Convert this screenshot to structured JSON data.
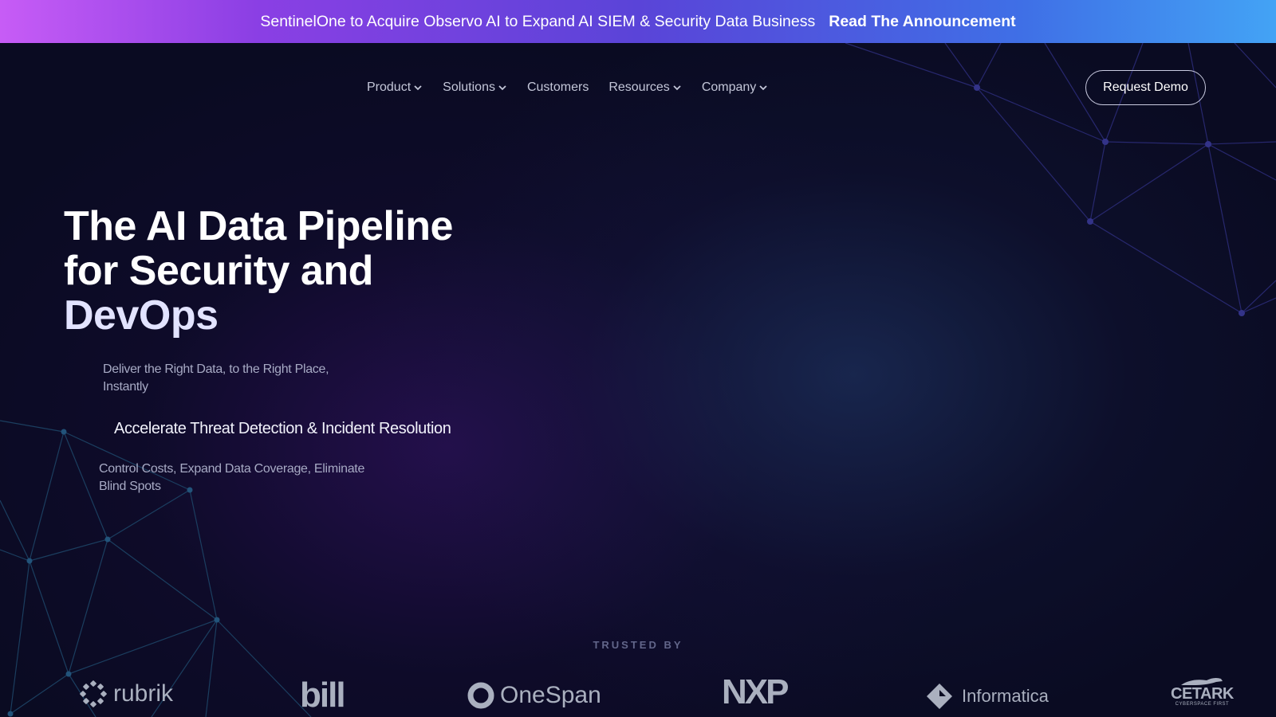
{
  "banner": {
    "text": "SentinelOne to Acquire Observo AI to Expand AI SIEM & Security Data Business",
    "link_label": "Read The Announcement"
  },
  "nav": {
    "items": [
      {
        "label": "Product",
        "has_dropdown": true
      },
      {
        "label": "Solutions",
        "has_dropdown": true
      },
      {
        "label": "Customers",
        "has_dropdown": false
      },
      {
        "label": "Resources",
        "has_dropdown": true
      },
      {
        "label": "Company",
        "has_dropdown": true
      }
    ],
    "cta_label": "Request Demo"
  },
  "hero": {
    "title_line1": "The AI Data Pipeline",
    "title_line2": "for Security and",
    "title_line3": "DevOps",
    "rotating_items": [
      "Deliver the Right Data, to the Right Place, Instantly",
      "Accelerate Threat Detection & Incident Resolution",
      "Control Costs, Expand Data Coverage, Eliminate Blind Spots"
    ],
    "active_item_index": 1
  },
  "trusted": {
    "label": "TRUSTED BY",
    "logos": [
      {
        "name": "rubrik",
        "icon": "rubrik-logo"
      },
      {
        "name": "bill",
        "icon": "bill-logo"
      },
      {
        "name": "OneSpan",
        "icon": "onespan-logo"
      },
      {
        "name": "NXP",
        "icon": "nxp-logo"
      },
      {
        "name": "Informatica",
        "icon": "informatica-logo"
      },
      {
        "name": "CETARK",
        "tagline": "CYBERSPACE FIRST",
        "icon": "cetark-logo"
      }
    ]
  },
  "colors": {
    "background": "#0a0b22",
    "banner_gradient_start": "#c75cf6",
    "banner_gradient_end": "#43a3f5",
    "network_top_right": "#2f2f7e",
    "network_bottom_left": "#1d4a6e",
    "logo_gray": "#aab0bf"
  }
}
